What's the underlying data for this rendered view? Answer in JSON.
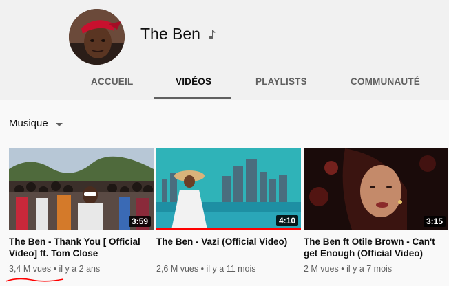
{
  "channel": {
    "name": "The Ben",
    "badge_icon": "music-note-icon"
  },
  "tabs": [
    {
      "label": "ACCUEIL",
      "active": false
    },
    {
      "label": "VIDÉOS",
      "active": true
    },
    {
      "label": "PLAYLISTS",
      "active": false
    },
    {
      "label": "COMMUNAUTÉ",
      "active": false
    }
  ],
  "section": {
    "label": "Musique"
  },
  "videos": [
    {
      "title": "The Ben - Thank You [ Official Video] ft. Tom Close",
      "duration": "3:59",
      "views": "3,4 M vues",
      "age": "il y a 2 ans",
      "separator": "•"
    },
    {
      "title": "The Ben - Vazi (Official Video)",
      "duration": "4:10",
      "views": "2,6 M vues",
      "age": "il y a 11 mois",
      "separator": "•",
      "watched_fraction": 1.0
    },
    {
      "title": "The Ben ft Otile Brown - Can't get Enough (Official Video)",
      "duration": "3:15",
      "views": "2 M vues",
      "age": "il y a 7 mois",
      "separator": "•"
    }
  ],
  "colors": {
    "progress": "#ff0000",
    "annotation": "#ff0000"
  }
}
